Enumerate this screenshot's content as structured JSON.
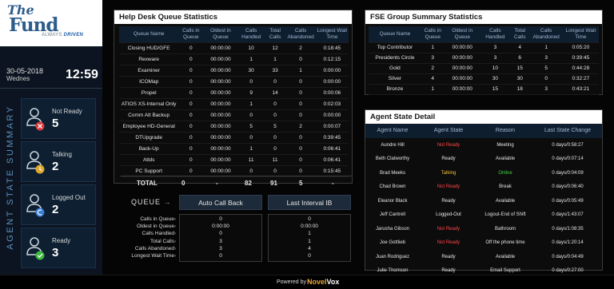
{
  "brand": {
    "logo_the": "The",
    "logo_fund": "Fund",
    "tagline": "ALWAYS",
    "tagline_bold": "DRIVEN"
  },
  "datetime": {
    "date": "30-05-2018",
    "day": "Wednes",
    "time": "12:59"
  },
  "sidebar": {
    "vertical_label": "AGENT STATE SUMMARY",
    "cards": [
      {
        "label": "Not Ready",
        "value": "5",
        "icon": "agent-not-ready-icon",
        "badge_color": "#d93a3a"
      },
      {
        "label": "Talking",
        "value": "2",
        "icon": "agent-talking-icon",
        "badge_color": "#e0a92c"
      },
      {
        "label": "Logged Out",
        "value": "2",
        "icon": "agent-logged-out-icon",
        "badge_color": "#3a7fd9"
      },
      {
        "label": "Ready",
        "value": "3",
        "icon": "agent-ready-icon",
        "badge_color": "#3fb93f"
      }
    ]
  },
  "helpdesk": {
    "title": "Help Desk Queue Statistics",
    "columns": [
      "Queue Name",
      "Calls in Queue",
      "Oldest in Queue",
      "Calls Handled",
      "Total Calls",
      "Calls Abandoned",
      "Longest Wait Time"
    ],
    "rows": [
      [
        "Closing HUD/GFE",
        "0",
        "00:00:00",
        "10",
        "12",
        "2",
        "0:18:45"
      ],
      [
        "Rexware",
        "0",
        "00:00:00",
        "1",
        "1",
        "0",
        "0:12:15"
      ],
      [
        "Examiner",
        "0",
        "00:00:00",
        "30",
        "33",
        "1",
        "0:00:00"
      ],
      [
        "ICOMap",
        "0",
        "00:00:00",
        "0",
        "0",
        "0",
        "0:00:00"
      ],
      [
        "Propel",
        "0",
        "00:00:00",
        "9",
        "14",
        "0",
        "0:00:06"
      ],
      [
        "ATIOS XS-Internal Only",
        "0",
        "00:00:00",
        "1",
        "0",
        "0",
        "0:02:03"
      ],
      [
        "Comm Att Backup",
        "0",
        "00:00:00",
        "0",
        "0",
        "0",
        "0:00:00"
      ],
      [
        "Employee HD-General",
        "0",
        "00:00:00",
        "5",
        "5",
        "2",
        "0:00:07"
      ],
      [
        "DTUpgrade",
        "0",
        "00:00:00",
        "0",
        "0",
        "0",
        "0:39:45"
      ],
      [
        "Back-Up",
        "0",
        "00:00:00",
        "1",
        "0",
        "0",
        "0:06:41"
      ],
      [
        "Atlds",
        "0",
        "00:00:00",
        "11",
        "11",
        "0",
        "0:06:41"
      ],
      [
        "PC Support",
        "0",
        "00:00:00",
        "0",
        "0",
        "0",
        "0:15:45"
      ]
    ],
    "total": {
      "label": "TOTAL",
      "calls_in_queue": "0",
      "oldest": "-",
      "handled": "82",
      "total_calls": "91",
      "abandoned": "5",
      "longest": "-"
    }
  },
  "queue": {
    "label": "QUEUE",
    "auto_call_back_label": "Auto Call Back",
    "last_interval_label": "Last Interval IB",
    "row_labels": [
      "Calls in Queue",
      "Oldest in Queue",
      "Calls Handled",
      "Total Calls",
      "Calls Abandoned",
      "Longest Wait Time"
    ],
    "auto_call_back_values": [
      "0",
      "0:00:00",
      "0",
      "3",
      "3",
      "0"
    ],
    "last_interval_values": [
      "0",
      "0:00:00",
      "1",
      "1",
      "4",
      "0"
    ]
  },
  "fse": {
    "title": "FSE Group Summary Statistics",
    "columns": [
      "Queue Name",
      "Calls in Queue",
      "Oldest in Queue",
      "Calls Handled",
      "Total Calls",
      "Calls Abandoned",
      "Longest Wait Time"
    ],
    "rows": [
      [
        "Top Contributor",
        "1",
        "00:00:00",
        "3",
        "4",
        "1",
        "0:05:20"
      ],
      [
        "Presidents Circle",
        "3",
        "00:00:00",
        "3",
        "6",
        "3",
        "0:39:45"
      ],
      [
        "Gold",
        "2",
        "00:00:00",
        "10",
        "15",
        "5",
        "0:44:28"
      ],
      [
        "Silver",
        "4",
        "00:00:00",
        "30",
        "30",
        "0",
        "0:32:27"
      ],
      [
        "Bronze",
        "1",
        "00:00:00",
        "15",
        "18",
        "3",
        "0:43:21"
      ]
    ]
  },
  "agents": {
    "title": "Agent State Detail",
    "columns": [
      "Agent Name",
      "Agent State",
      "Reason",
      "Last State Change"
    ],
    "rows": [
      {
        "name": "Aundre Hill",
        "state": "Not Ready",
        "state_class": "notready",
        "reason": "Meeting",
        "reason_class": "",
        "change": "0 days/0:58:27"
      },
      {
        "name": "Beth Clatworthy",
        "state": "Ready",
        "state_class": "",
        "reason": "Available",
        "reason_class": "",
        "change": "0 days/0:07:14"
      },
      {
        "name": "Brad Meeks",
        "state": "Talking",
        "state_class": "talking",
        "reason": "Online",
        "reason_class": "online",
        "change": "0 days/0:04:09"
      },
      {
        "name": "Chad Brown",
        "state": "Not Ready",
        "state_class": "notready",
        "reason": "Break",
        "reason_class": "",
        "change": "0 days/0:06:40"
      },
      {
        "name": "Eleanor Black",
        "state": "Ready",
        "state_class": "",
        "reason": "Available",
        "reason_class": "",
        "change": "0 days/0:05:49"
      },
      {
        "name": "Jeff Cantrell",
        "state": "Logged-Out",
        "state_class": "",
        "reason": "Logout-End of Shift",
        "reason_class": "",
        "change": "0 days/1:43:07"
      },
      {
        "name": "Jarusha Gibson",
        "state": "Not Ready",
        "state_class": "notready",
        "reason": "Bathroom",
        "reason_class": "",
        "change": "0 days/1:08:35"
      },
      {
        "name": "Joe Gottlieb",
        "state": "Not Ready",
        "state_class": "notready",
        "reason": "Off the phone time",
        "reason_class": "",
        "change": "0 days/1:20:14"
      },
      {
        "name": "Juan Rodriguez",
        "state": "Ready",
        "state_class": "",
        "reason": "Available",
        "reason_class": "",
        "change": "0 days/0:04:49"
      },
      {
        "name": "Julie Thomson",
        "state": "Ready",
        "state_class": "",
        "reason": "Email Support",
        "reason_class": "",
        "change": "0 days/0:27:00"
      }
    ]
  },
  "footer": {
    "powered_by": "Powered by -",
    "brand_a": "Novel",
    "brand_b": "Vox"
  }
}
